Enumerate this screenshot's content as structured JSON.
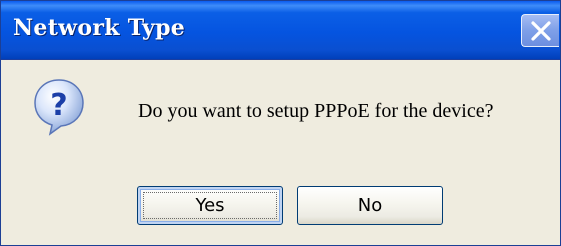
{
  "window": {
    "title": "Network Type"
  },
  "dialog": {
    "icon": "question-icon",
    "message": "Do you want to setup PPPoE for the device?",
    "buttons": {
      "yes_label": "Yes",
      "no_label": "No"
    }
  },
  "colors": {
    "titlebar": "#0554e0",
    "dialog_bg": "#ece9d8",
    "close_button": "#7e9fe8"
  }
}
